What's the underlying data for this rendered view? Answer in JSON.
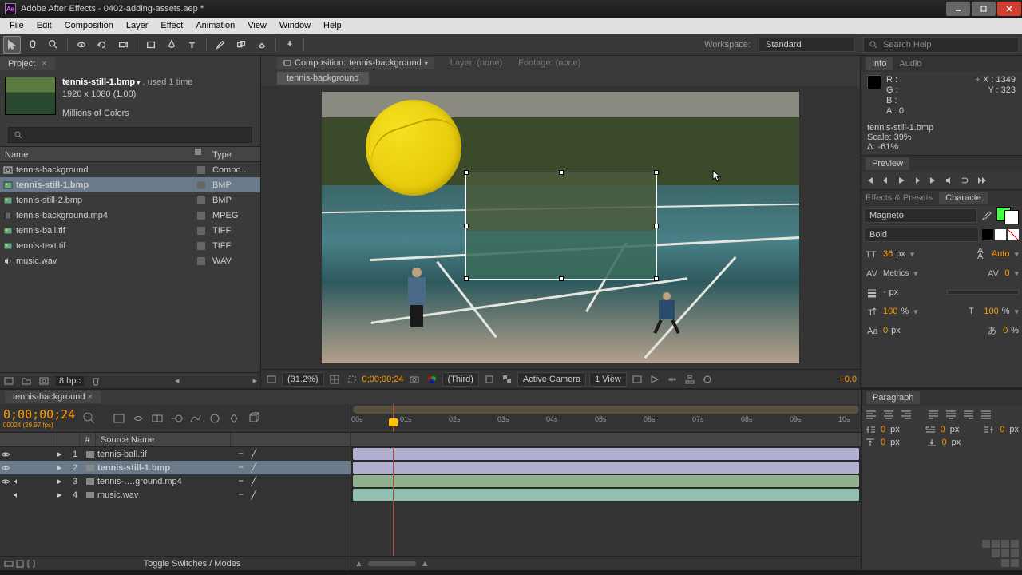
{
  "window": {
    "title": "Adobe After Effects - 0402-adding-assets.aep *"
  },
  "menu": [
    "File",
    "Edit",
    "Composition",
    "Layer",
    "Effect",
    "Animation",
    "View",
    "Window",
    "Help"
  ],
  "workspace": {
    "label": "Workspace:",
    "value": "Standard"
  },
  "search": {
    "placeholder": "Search Help"
  },
  "project": {
    "panel": "Project",
    "thumb": {
      "name": "tennis-still-1.bmp",
      "used": ", used 1 time",
      "dims": "1920 x 1080 (1.00)",
      "colors": "Millions of Colors"
    },
    "cols": {
      "name": "Name",
      "type": "Type"
    },
    "items": [
      {
        "name": "tennis-background",
        "type": "Compo…",
        "icon": "comp"
      },
      {
        "name": "tennis-still-1.bmp",
        "type": "BMP",
        "icon": "img",
        "sel": true
      },
      {
        "name": "tennis-still-2.bmp",
        "type": "BMP",
        "icon": "img"
      },
      {
        "name": "tennis-background.mp4",
        "type": "MPEG",
        "icon": "vid"
      },
      {
        "name": "tennis-ball.tif",
        "type": "TIFF",
        "icon": "img"
      },
      {
        "name": "tennis-text.tif",
        "type": "TIFF",
        "icon": "img"
      },
      {
        "name": "music.wav",
        "type": "WAV",
        "icon": "aud"
      }
    ],
    "bpc": "8 bpc"
  },
  "comp": {
    "tabs": {
      "t1_pre": "Composition:",
      "t1": "tennis-background",
      "t2": "Layer: (none)",
      "t3": "Footage: (none)"
    },
    "crumb": "tennis-background",
    "footer": {
      "mag": "(31.2%)",
      "time": "0;00;00;24",
      "res": "(Third)",
      "cam": "Active Camera",
      "view": "1 View",
      "exposure": "+0.0"
    }
  },
  "info": {
    "panel": "Info",
    "panel2": "Audio",
    "r": "R :",
    "g": "G :",
    "b": "B :",
    "a": "A :  0",
    "x": "X : 1349",
    "y": "Y : 323",
    "file": "tennis-still-1.bmp",
    "scale": "Scale: 39%",
    "delta": "Δ: -61%"
  },
  "preview": {
    "panel": "Preview"
  },
  "effects": {
    "panel": "Effects & Presets",
    "panel2": "Characte"
  },
  "char": {
    "font": "Magneto",
    "style": "Bold",
    "size": "36",
    "sizeu": "px",
    "lead": "Auto",
    "kern": "Metrics",
    "track": "0",
    "stroke": "-",
    "strokeu": "px",
    "hscale": "100",
    "hscaleu": "%",
    "vscale": "100",
    "vscaleu": "%",
    "base": "0",
    "baseu": "px",
    "tsume": "0",
    "tsumeu": "%"
  },
  "para": {
    "panel": "Paragraph",
    "il": "0",
    "ilu": "px",
    "ir": "0",
    "iru": "px",
    "fl": "0",
    "flu": "px",
    "sb": "0",
    "sbu": "px",
    "sa": "0",
    "sau": "px"
  },
  "timeline": {
    "tab": "tennis-background",
    "time": "0;00;00;24",
    "sub": "00024 (29.97 fps)",
    "hdr": {
      "num": "#",
      "src": "Source Name"
    },
    "layers": [
      {
        "n": "1",
        "name": "tennis-ball.tif",
        "color": "#b0b0d0",
        "eye": true
      },
      {
        "n": "2",
        "name": "tennis-still-1.bmp",
        "color": "#b0b0d0",
        "eye": true,
        "sel": true
      },
      {
        "n": "3",
        "name": "tennis-….ground.mp4",
        "color": "#90b090",
        "eye": true,
        "spk": true
      },
      {
        "n": "4",
        "name": "music.wav",
        "color": "#90c0b0",
        "spk": true
      }
    ],
    "ticks": [
      "00s",
      "01s",
      "02s",
      "03s",
      "04s",
      "05s",
      "06s",
      "07s",
      "08s",
      "09s",
      "10s"
    ],
    "toggle": "Toggle Switches / Modes"
  }
}
